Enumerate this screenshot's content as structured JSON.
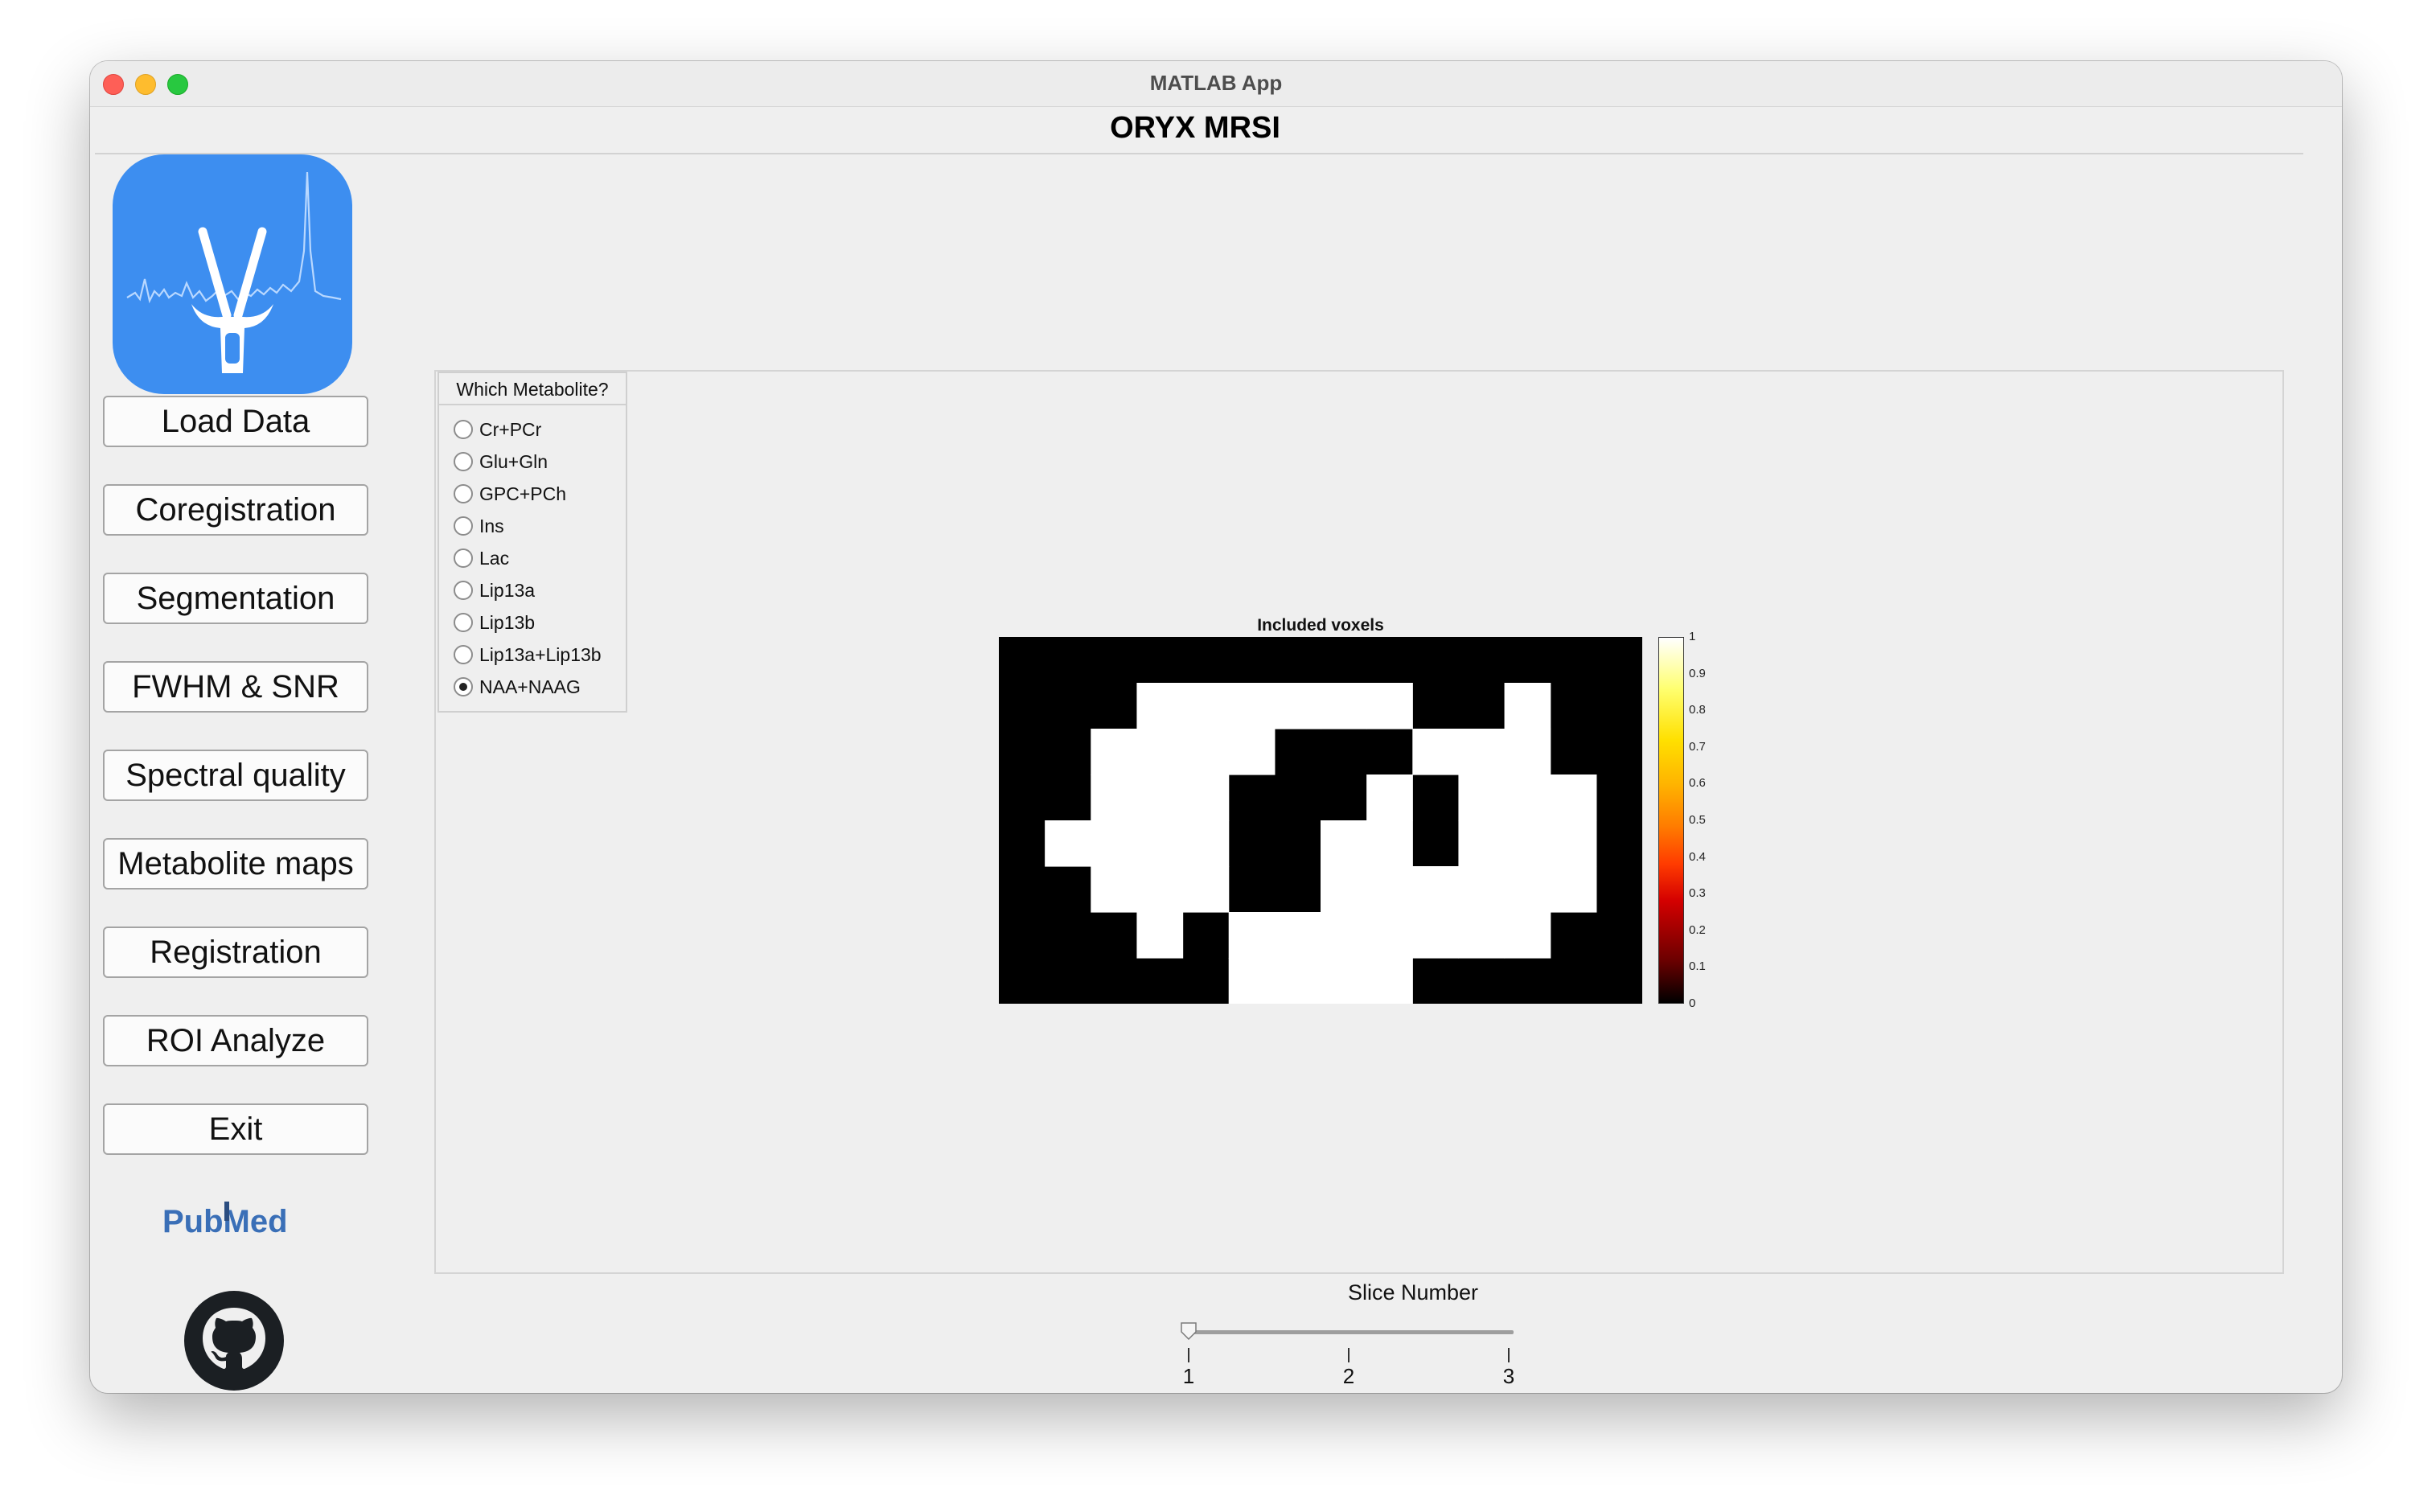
{
  "window": {
    "title": "MATLAB App",
    "controls": [
      "close",
      "minimize",
      "zoom"
    ]
  },
  "app": {
    "title": "ORYX MRSI",
    "logo_icon": "oryx-spectrum-logo"
  },
  "nav": {
    "buttons": [
      "Load Data",
      "Coregistration",
      "Segmentation",
      "FWHM & SNR",
      "Spectral quality",
      "Metabolite maps",
      "Registration",
      "ROI Analyze",
      "Exit"
    ],
    "pubmed_text": "PubMed",
    "github_icon": "github-icon"
  },
  "metabolite_group": {
    "title": "Which Metabolite?",
    "options": [
      "Cr+PCr",
      "Glu+Gln",
      "GPC+PCh",
      "Ins",
      "Lac",
      "Lip13a",
      "Lip13b",
      "Lip13a+Lip13b",
      "NAA+NAAG"
    ],
    "selected": "NAA+NAAG"
  },
  "plot": {
    "title": "Included voxels",
    "colormap": "hot",
    "grid_cols": 14,
    "grid_rows": 8,
    "mask": [
      "00000000000000",
      "00011111100100",
      "00111111111100",
      "00111111111110",
      "01111111111110",
      "00111111111110",
      "00011111111100",
      "00000111100000"
    ],
    "excluded_inner": [
      [
        6,
        2
      ],
      [
        7,
        2
      ],
      [
        8,
        2
      ],
      [
        5,
        3
      ],
      [
        6,
        3
      ],
      [
        7,
        3
      ],
      [
        9,
        3
      ],
      [
        5,
        4
      ],
      [
        6,
        4
      ],
      [
        9,
        4
      ],
      [
        5,
        5
      ],
      [
        6,
        5
      ],
      [
        4,
        6
      ]
    ],
    "colorbar_ticks": [
      "1",
      "0.9",
      "0.8",
      "0.7",
      "0.6",
      "0.5",
      "0.4",
      "0.3",
      "0.2",
      "0.1",
      "0"
    ]
  },
  "slider": {
    "label": "Slice Number",
    "min": 1,
    "max": 3,
    "value": 1,
    "ticks": [
      "1",
      "2",
      "3"
    ]
  },
  "colors": {
    "window_bg": "#efefef",
    "logo_bg": "#3d8ef0",
    "pubmed_blue": "#3a6fb7"
  }
}
